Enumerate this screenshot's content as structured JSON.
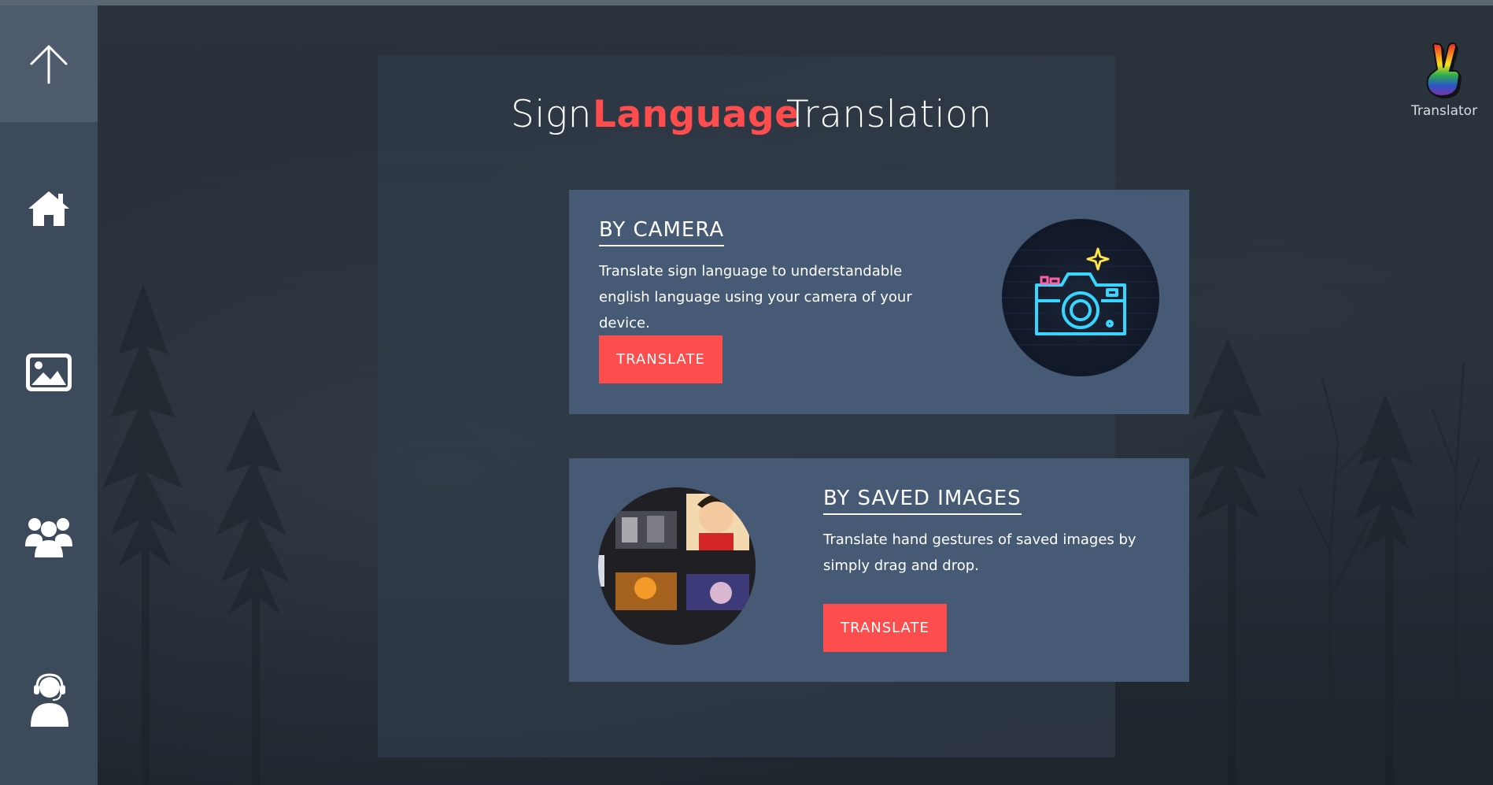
{
  "page": {
    "title_part1": "Sign",
    "title_highlight": "Language",
    "title_part2": "Translation"
  },
  "brand": {
    "label": "Translator",
    "icon": "peace-hand-rainbow-icon"
  },
  "sidebar": {
    "items": [
      {
        "name": "scroll-up",
        "icon": "arrow-up-icon"
      },
      {
        "name": "home",
        "icon": "home-icon"
      },
      {
        "name": "images",
        "icon": "image-icon"
      },
      {
        "name": "team",
        "icon": "users-icon"
      },
      {
        "name": "support",
        "icon": "support-agent-icon"
      }
    ]
  },
  "cards": [
    {
      "heading": "BY CAMERA",
      "description": "Translate sign language to understandable english language using your camera of your device.",
      "button_label": "TRANSLATE",
      "image_icon": "neon-camera-icon"
    },
    {
      "heading": "BY SAVED IMAGES",
      "description": "Translate hand gestures of saved images by simply drag and drop.",
      "button_label": "TRANSLATE",
      "image_icon": "image-collage-icon"
    }
  ],
  "colors": {
    "accent": "#fd4d4d",
    "sidebar": "#3d4a5b",
    "card": "#465a75",
    "background": "#232a33"
  }
}
